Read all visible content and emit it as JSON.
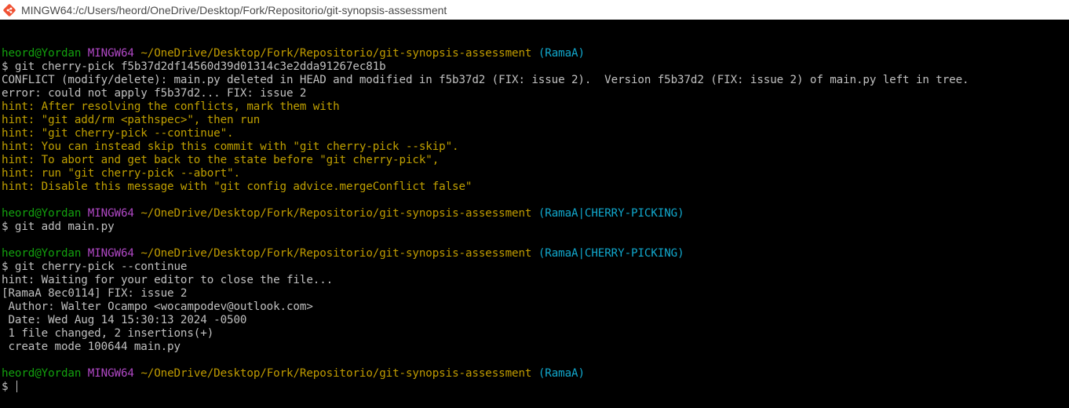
{
  "window": {
    "title": "MINGW64:/c/Users/heord/OneDrive/Desktop/Fork/Repositorio/git-synopsis-assessment",
    "icon": "git-icon"
  },
  "colors": {
    "background": "#000000",
    "default_text": "#c0c0c0",
    "hint_text": "#c0a000",
    "user_host": "#13a10e",
    "mingw": "#b148c6",
    "path": "#c19c00",
    "branch": "#11a8cd"
  },
  "terminal": {
    "lines": [
      {
        "type": "blank"
      },
      {
        "type": "prompt",
        "user": "heord@Yordan",
        "env": "MINGW64",
        "path": "~/OneDrive/Desktop/Fork/Repositorio/git-synopsis-assessment",
        "branch": "(RamaA)"
      },
      {
        "type": "cmd",
        "text": "$ git cherry-pick f5b37d2df14560d39d01314c3e2dda91267ec81b"
      },
      {
        "type": "out",
        "text": "CONFLICT (modify/delete): main.py deleted in HEAD and modified in f5b37d2 (FIX: issue 2).  Version f5b37d2 (FIX: issue 2) of main.py left in tree."
      },
      {
        "type": "out",
        "text": "error: could not apply f5b37d2... FIX: issue 2"
      },
      {
        "type": "hint",
        "text": "hint: After resolving the conflicts, mark them with"
      },
      {
        "type": "hint",
        "text": "hint: \"git add/rm <pathspec>\", then run"
      },
      {
        "type": "hint",
        "text": "hint: \"git cherry-pick --continue\"."
      },
      {
        "type": "hint",
        "text": "hint: You can instead skip this commit with \"git cherry-pick --skip\"."
      },
      {
        "type": "hint",
        "text": "hint: To abort and get back to the state before \"git cherry-pick\","
      },
      {
        "type": "hint",
        "text": "hint: run \"git cherry-pick --abort\"."
      },
      {
        "type": "hint",
        "text": "hint: Disable this message with \"git config advice.mergeConflict false\""
      },
      {
        "type": "blank"
      },
      {
        "type": "prompt",
        "user": "heord@Yordan",
        "env": "MINGW64",
        "path": "~/OneDrive/Desktop/Fork/Repositorio/git-synopsis-assessment",
        "branch": "(RamaA|CHERRY-PICKING)"
      },
      {
        "type": "cmd",
        "text": "$ git add main.py"
      },
      {
        "type": "blank"
      },
      {
        "type": "prompt",
        "user": "heord@Yordan",
        "env": "MINGW64",
        "path": "~/OneDrive/Desktop/Fork/Repositorio/git-synopsis-assessment",
        "branch": "(RamaA|CHERRY-PICKING)"
      },
      {
        "type": "cmd",
        "text": "$ git cherry-pick --continue"
      },
      {
        "type": "out",
        "text": "hint: Waiting for your editor to close the file..."
      },
      {
        "type": "out",
        "text": "[RamaA 8ec0114] FIX: issue 2"
      },
      {
        "type": "out",
        "text": " Author: Walter Ocampo <wocampodev@outlook.com>"
      },
      {
        "type": "out",
        "text": " Date: Wed Aug 14 15:30:13 2024 -0500"
      },
      {
        "type": "out",
        "text": " 1 file changed, 2 insertions(+)"
      },
      {
        "type": "out",
        "text": " create mode 100644 main.py"
      },
      {
        "type": "blank"
      },
      {
        "type": "prompt",
        "user": "heord@Yordan",
        "env": "MINGW64",
        "path": "~/OneDrive/Desktop/Fork/Repositorio/git-synopsis-assessment",
        "branch": "(RamaA)"
      },
      {
        "type": "input",
        "text": "$ "
      }
    ]
  }
}
